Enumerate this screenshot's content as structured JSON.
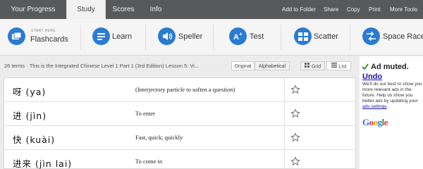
{
  "top_tabs": [
    {
      "label": "Your Progress"
    },
    {
      "label": "Study"
    },
    {
      "label": "Scores"
    },
    {
      "label": "Info"
    }
  ],
  "top_links": [
    "Add to Folder",
    "Share",
    "Copy",
    "Print",
    "More Tools"
  ],
  "modes": [
    {
      "sub": "START HERE",
      "label": "Flashcards"
    },
    {
      "label": "Learn"
    },
    {
      "label": "Speller"
    },
    {
      "label": "Test"
    },
    {
      "label": "Scatter"
    },
    {
      "label": "Space Race"
    }
  ],
  "info": {
    "text": "26 terms · This is the Integrated Chinese Level 1 Part 1 (3rd Edition) Lesson 5: Vi...",
    "sort_original": "Original",
    "sort_alpha": "Alphabetical",
    "view_grid": "Grid",
    "view_list": "List"
  },
  "terms": [
    {
      "term": "呀 (ya)",
      "definition": "(Interjectory particle to soften a question)"
    },
    {
      "term": "进 (jìn)",
      "definition": "To enter"
    },
    {
      "term": "快 (kuài)",
      "definition": "Fast, quick; quickly"
    },
    {
      "term": "进来 (jìn lai)",
      "definition": "To come in"
    }
  ],
  "ad": {
    "title": "Ad muted.",
    "undo": "Undo",
    "line1": "We'll do our best to show you more relevant ads in the future.",
    "line2": "Help us show you better ads by updating your",
    "link": "ads settings",
    "brand": "Google"
  },
  "colors": {
    "accent": "#2b7bd0",
    "topbar": "#58595b",
    "link": "#1a0dab"
  }
}
